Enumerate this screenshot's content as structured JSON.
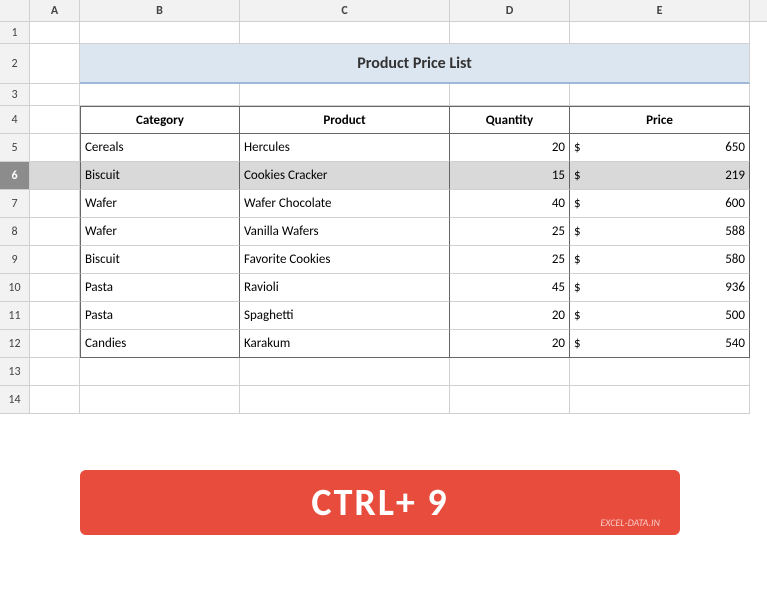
{
  "title": "Product Price List",
  "columns": [
    "A",
    "B",
    "C",
    "D",
    "E"
  ],
  "col_headers": {
    "a": "A",
    "b": "B",
    "c": "C",
    "d": "D",
    "e": "E"
  },
  "table_headers": {
    "category": "Category",
    "product": "Product",
    "quantity": "Quantity",
    "price": "Price"
  },
  "rows": [
    {
      "row": "5",
      "category": "Cereals",
      "product": "Hercules",
      "quantity": "20",
      "price_sym": "$",
      "price_val": "650"
    },
    {
      "row": "6",
      "category": "Biscuit",
      "product": "Cookies Cracker",
      "quantity": "15",
      "price_sym": "$",
      "price_val": "219",
      "selected": true
    },
    {
      "row": "7",
      "category": "Wafer",
      "product": "Wafer Chocolate",
      "quantity": "40",
      "price_sym": "$",
      "price_val": "600"
    },
    {
      "row": "8",
      "category": "Wafer",
      "product": "Vanilla Wafers",
      "quantity": "25",
      "price_sym": "$",
      "price_val": "588"
    },
    {
      "row": "9",
      "category": "Biscuit",
      "product": "Favorite Cookies",
      "quantity": "25",
      "price_sym": "$",
      "price_val": "580"
    },
    {
      "row": "10",
      "category": "Pasta",
      "product": "Ravioli",
      "quantity": "45",
      "price_sym": "$",
      "price_val": "936"
    },
    {
      "row": "11",
      "category": "Pasta",
      "product": "Spaghetti",
      "quantity": "20",
      "price_sym": "$",
      "price_val": "500"
    },
    {
      "row": "12",
      "category": "Candies",
      "product": "Karakum",
      "quantity": "20",
      "price_sym": "$",
      "price_val": "540"
    }
  ],
  "shortcut": {
    "text": "CTRL+ 9",
    "subtext": "EXCEL-DATA.IN"
  },
  "empty_rows": [
    "1",
    "3",
    "13",
    "14"
  ]
}
